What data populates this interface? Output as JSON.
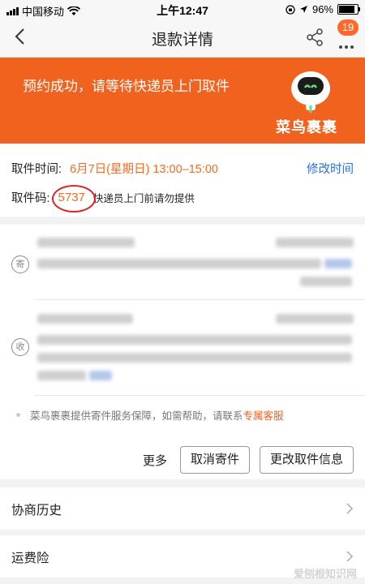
{
  "status_bar": {
    "carrier": "中国移动",
    "time": "上午12:47",
    "battery_text": "96%",
    "battery_level": 0.96
  },
  "nav": {
    "title": "退款详情",
    "badge_count": "19"
  },
  "banner": {
    "message": "预约成功，请等待快递员上门取件",
    "brand": "菜鸟裹裹",
    "color": "#f1621f"
  },
  "pickup": {
    "time_label": "取件时间:",
    "time_value": "6月7日(星期日) 13:00–15:00",
    "modify_label": "修改时间",
    "code_label": "取件码:",
    "code_value": "5737",
    "code_note": "快递员上门前请勿提供"
  },
  "addresses": {
    "sender_icon": "寄",
    "receiver_icon": "收"
  },
  "notice": {
    "text": "菜鸟裹裹提供寄件服务保障，如需帮助，请联系",
    "link": "专属客服"
  },
  "actions": {
    "more": "更多",
    "cancel": "取消寄件",
    "change": "更改取件信息"
  },
  "list": {
    "history": "协商历史",
    "insurance": "运费险"
  },
  "watermark": "爱刨根知识网"
}
